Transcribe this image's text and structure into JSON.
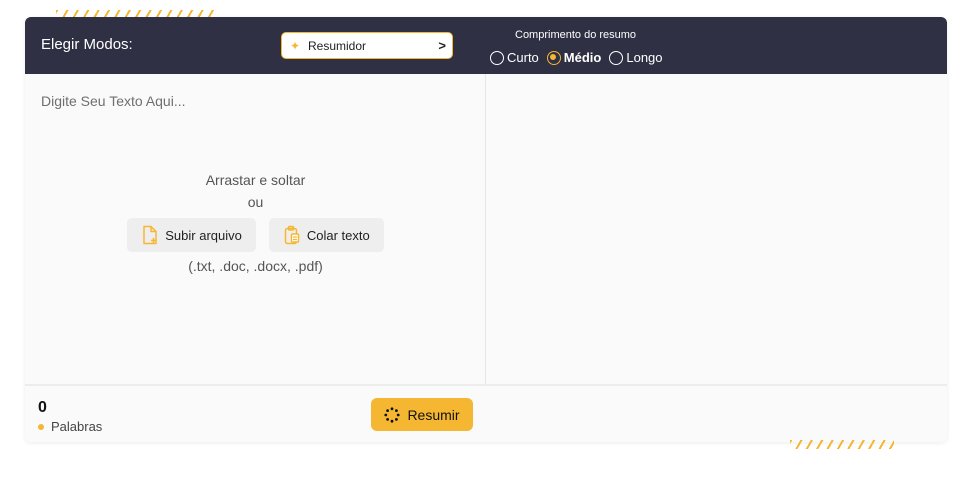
{
  "header": {
    "title": "Elegir Modos:",
    "mode": {
      "label": "Resumidor",
      "icon": "sparkle-icon",
      "chevron": ">"
    },
    "length": {
      "title": "Comprimento do resumo",
      "options": [
        {
          "label": "Curto",
          "selected": false
        },
        {
          "label": "Médio",
          "selected": true
        },
        {
          "label": "Longo",
          "selected": false
        }
      ]
    }
  },
  "input": {
    "placeholder": "Digite Seu Texto Aqui...",
    "drop_text": "Arrastar e soltar",
    "or_text": "ou",
    "upload_label": "Subir arquivo",
    "paste_label": "Colar texto",
    "formats": "(.txt, .doc, .docx, .pdf)"
  },
  "footer": {
    "word_count": "0",
    "word_label": "Palabras",
    "summarize_label": "Resumir"
  },
  "colors": {
    "accent": "#f5b731",
    "header_bg": "#2f3044"
  }
}
